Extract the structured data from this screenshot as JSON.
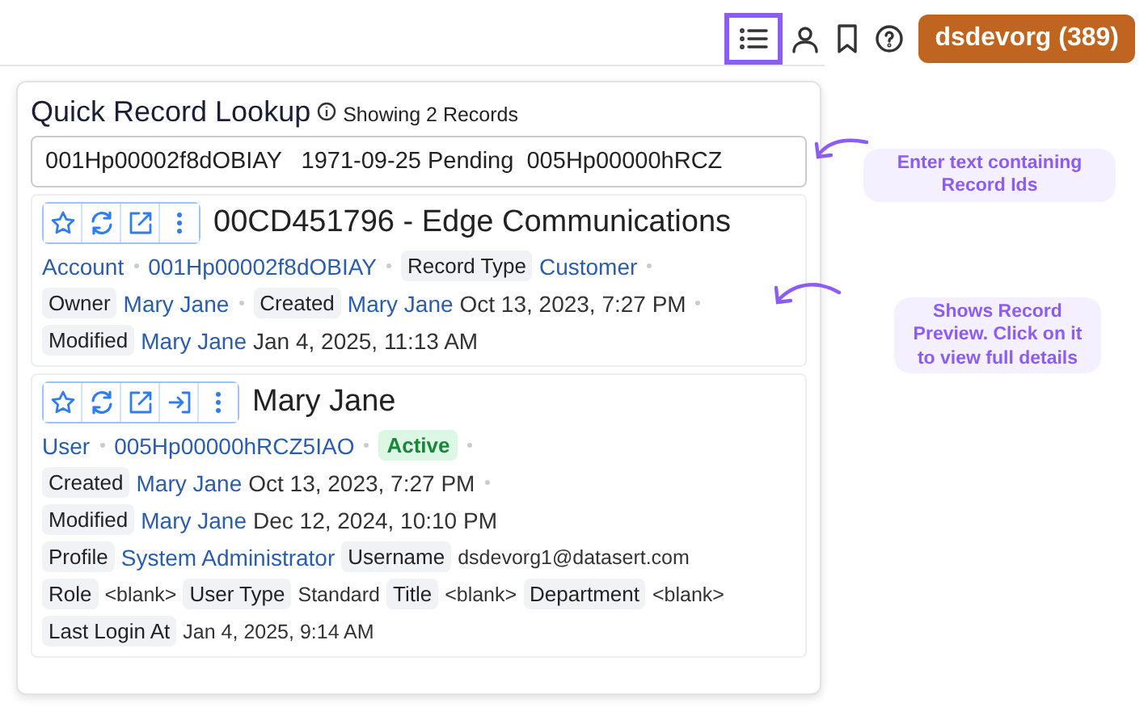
{
  "toolbar": {
    "icons": [
      {
        "kind": "list",
        "selected": true
      },
      {
        "kind": "user",
        "selected": false
      },
      {
        "kind": "bookmark",
        "selected": false
      },
      {
        "kind": "help",
        "selected": false
      }
    ],
    "org_button": "dsdevorg (389)"
  },
  "lookup": {
    "title": "Quick Record Lookup",
    "status": "Showing 2 Records",
    "input_value": "001Hp00002f8dOBIAY   1971-09-25 Pending  005Hp00000hRCZ",
    "records": [
      {
        "actions": [
          {
            "kind": "star"
          },
          {
            "kind": "refresh"
          },
          {
            "kind": "open"
          },
          {
            "kind": "more"
          }
        ],
        "title": "00CD451796 - Edge Communications",
        "lines": [
          [
            {
              "kind": "link",
              "text": "Account",
              "sep": true
            },
            {
              "kind": "link",
              "text": "001Hp00002f8dOBIAY",
              "sep": true
            },
            {
              "kind": "label",
              "text": "Record Type"
            },
            {
              "kind": "link",
              "text": "Customer",
              "sep": true
            }
          ],
          [
            {
              "kind": "label",
              "text": "Owner"
            },
            {
              "kind": "link",
              "text": "Mary Jane",
              "sep": true
            },
            {
              "kind": "label",
              "text": "Created"
            },
            {
              "kind": "link",
              "text": "Mary Jane"
            },
            {
              "kind": "text",
              "text": "Oct 13, 2023, 7:27 PM",
              "sep": true
            }
          ],
          [
            {
              "kind": "label",
              "text": "Modified"
            },
            {
              "kind": "link",
              "text": "Mary Jane"
            },
            {
              "kind": "text",
              "text": "Jan 4, 2025, 11:13 AM"
            }
          ]
        ]
      },
      {
        "actions": [
          {
            "kind": "star"
          },
          {
            "kind": "refresh"
          },
          {
            "kind": "open"
          },
          {
            "kind": "login"
          },
          {
            "kind": "more"
          }
        ],
        "title": "Mary Jane",
        "lines": [
          [
            {
              "kind": "link",
              "text": "User",
              "sep": true
            },
            {
              "kind": "link",
              "text": "005Hp00000hRCZ5IAO",
              "sep": true
            },
            {
              "kind": "badge",
              "text": "Active",
              "sep": true
            }
          ],
          [
            {
              "kind": "label",
              "text": "Created"
            },
            {
              "kind": "link",
              "text": "Mary Jane"
            },
            {
              "kind": "text",
              "text": "Oct 13, 2023, 7:27 PM",
              "sep": true
            }
          ],
          [
            {
              "kind": "label",
              "text": "Modified"
            },
            {
              "kind": "link",
              "text": "Mary Jane"
            },
            {
              "kind": "text",
              "text": "Dec 12, 2024, 10:10 PM"
            }
          ],
          [
            {
              "kind": "label",
              "text": "Profile"
            },
            {
              "kind": "link",
              "text": "System Administrator"
            },
            {
              "kind": "label",
              "text": "Username"
            },
            {
              "kind": "small",
              "text": "dsdevorg1@datasert.com"
            }
          ],
          [
            {
              "kind": "label",
              "text": "Role"
            },
            {
              "kind": "small",
              "text": "<blank>"
            },
            {
              "kind": "label",
              "text": "User Type"
            },
            {
              "kind": "small",
              "text": "Standard"
            },
            {
              "kind": "label",
              "text": "Title"
            },
            {
              "kind": "small",
              "text": "<blank>"
            },
            {
              "kind": "label",
              "text": "Department"
            },
            {
              "kind": "small",
              "text": "<blank>"
            }
          ],
          [
            {
              "kind": "label",
              "text": "Last Login At"
            },
            {
              "kind": "small",
              "text": "Jan 4, 2025, 9:14 AM"
            }
          ]
        ]
      }
    ]
  },
  "annotations": [
    {
      "kind": "input",
      "text": "Enter text containing Record Ids"
    },
    {
      "kind": "preview",
      "text": "Shows Record Preview. Click on it to view full details"
    }
  ]
}
